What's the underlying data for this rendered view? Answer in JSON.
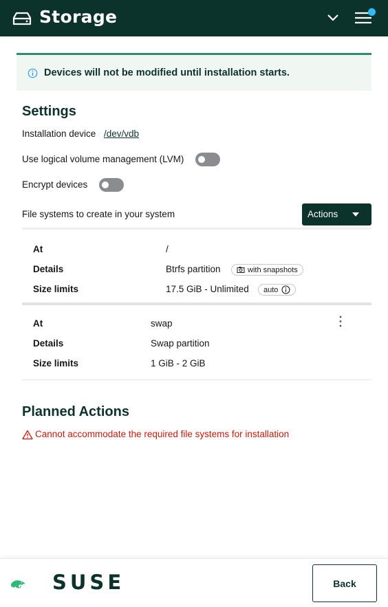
{
  "header": {
    "title": "Storage",
    "colors": {
      "background": "#0c322c",
      "notification_dot": "#30baff"
    }
  },
  "alert": {
    "text": "Devices will not be modified until installation starts.",
    "icon": "info-icon"
  },
  "settings": {
    "title": "Settings",
    "installation_device_label": "Installation device",
    "installation_device_value": "/dev/vdb",
    "lvm_label": "Use logical volume management (LVM)",
    "lvm_enabled": false,
    "encrypt_label": "Encrypt devices",
    "encrypt_enabled": false,
    "filesystems_label": "File systems to create in your system",
    "actions_label": "Actions"
  },
  "filesystems": [
    {
      "at_key": "At",
      "at": "/",
      "details_key": "Details",
      "details": "Btrfs partition",
      "details_badge": "with snapshots",
      "size_key": "Size limits",
      "size": "17.5 GiB - Unlimited",
      "size_badge": "auto"
    },
    {
      "at_key": "At",
      "at": "swap",
      "details_key": "Details",
      "details": "Swap partition",
      "size_key": "Size limits",
      "size": "1 GiB - 2 GiB"
    }
  ],
  "planned": {
    "title": "Planned Actions",
    "error": "Cannot accommodate the required file systems for installation",
    "error_color": "#c9190b"
  },
  "footer": {
    "logo_text": "SUSE",
    "back_label": "Back"
  }
}
